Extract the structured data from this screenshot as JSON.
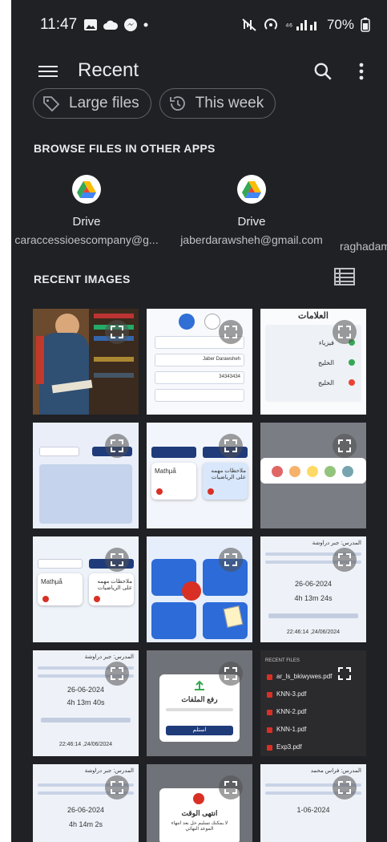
{
  "status_bar": {
    "time": "11:47",
    "icons_left": [
      "gallery-icon",
      "cloud-icon",
      "messenger-icon",
      "dot-icon"
    ],
    "icons_right": [
      "mute-icon",
      "hotspot-icon",
      "signal-icon",
      "battery-icon"
    ],
    "battery": "70%"
  },
  "app_bar": {
    "title": "Recent"
  },
  "chips": [
    {
      "label": "Large files",
      "icon": "tag-icon"
    },
    {
      "label": "This week",
      "icon": "history-icon"
    }
  ],
  "browse": {
    "heading": "BROWSE FILES IN OTHER APPS",
    "apps": [
      {
        "name": "Drive",
        "account": "caraccessioescompany@g..."
      },
      {
        "name": "Drive",
        "account": "jaberdarawsheh@gmail.com"
      },
      {
        "name": "",
        "account": "raghadam"
      }
    ]
  },
  "recent_images": {
    "heading": "RECENT IMAGES",
    "tiles": [
      {
        "kind": "photo-student"
      },
      {
        "kind": "profile-form",
        "name": "Jaber Darawsheh",
        "phone": "34343434"
      },
      {
        "kind": "grades-table",
        "title": "العلامات",
        "rows": [
          "فيزياء",
          "الخليج",
          "الخليج"
        ]
      },
      {
        "kind": "keyboard"
      },
      {
        "kind": "notes-cards",
        "card_left": "Mathµå",
        "card_right": "ملاحظات مهمه على الرياضيات"
      },
      {
        "kind": "color-picker"
      },
      {
        "kind": "notes-cards-2",
        "card_left": "Mathµå",
        "card_right": "ملاحظات مهمه على الرياضيات"
      },
      {
        "kind": "course-menu"
      },
      {
        "kind": "assignment",
        "heading": "المدرس: جبر دراوشة",
        "date": "26-06-2024",
        "remaining": "4h 13m 24s",
        "timestamp": "22:46:14 ,24/06/2024"
      },
      {
        "kind": "assignment",
        "heading": "المدرس: جبر دراوشة",
        "date": "26-06-2024",
        "remaining": "4h 13m 40s",
        "timestamp": "22:46:14 ,24/06/2024"
      },
      {
        "kind": "upload-dialog",
        "dialog_title": "رفع الملفات",
        "button": "استلم"
      },
      {
        "kind": "file-list",
        "header": "RECENT FILES",
        "files": [
          "ar_ls_bkiwywes.pdf",
          "KNN-3.pdf",
          "KNN-2.pdf",
          "KNN-1.pdf",
          "Exp3.pdf"
        ]
      },
      {
        "kind": "assignment",
        "heading": "المدرس: جبر دراوشة",
        "date": "26-06-2024",
        "remaining": "4h 14m 2s"
      },
      {
        "kind": "time-over",
        "dialog_title": "انتهى الوقت",
        "body": "لا يمكنك تسليم حل بعد انتهاء الموعد النهائي"
      },
      {
        "kind": "assignment",
        "heading": "المدرس: فراس محمد",
        "date": "1-06-2024"
      }
    ]
  },
  "colors": {
    "background": "#202124",
    "text": "#e8eaed",
    "chip_border": "#5f6368",
    "accent_blue": "#1f3b7a"
  }
}
